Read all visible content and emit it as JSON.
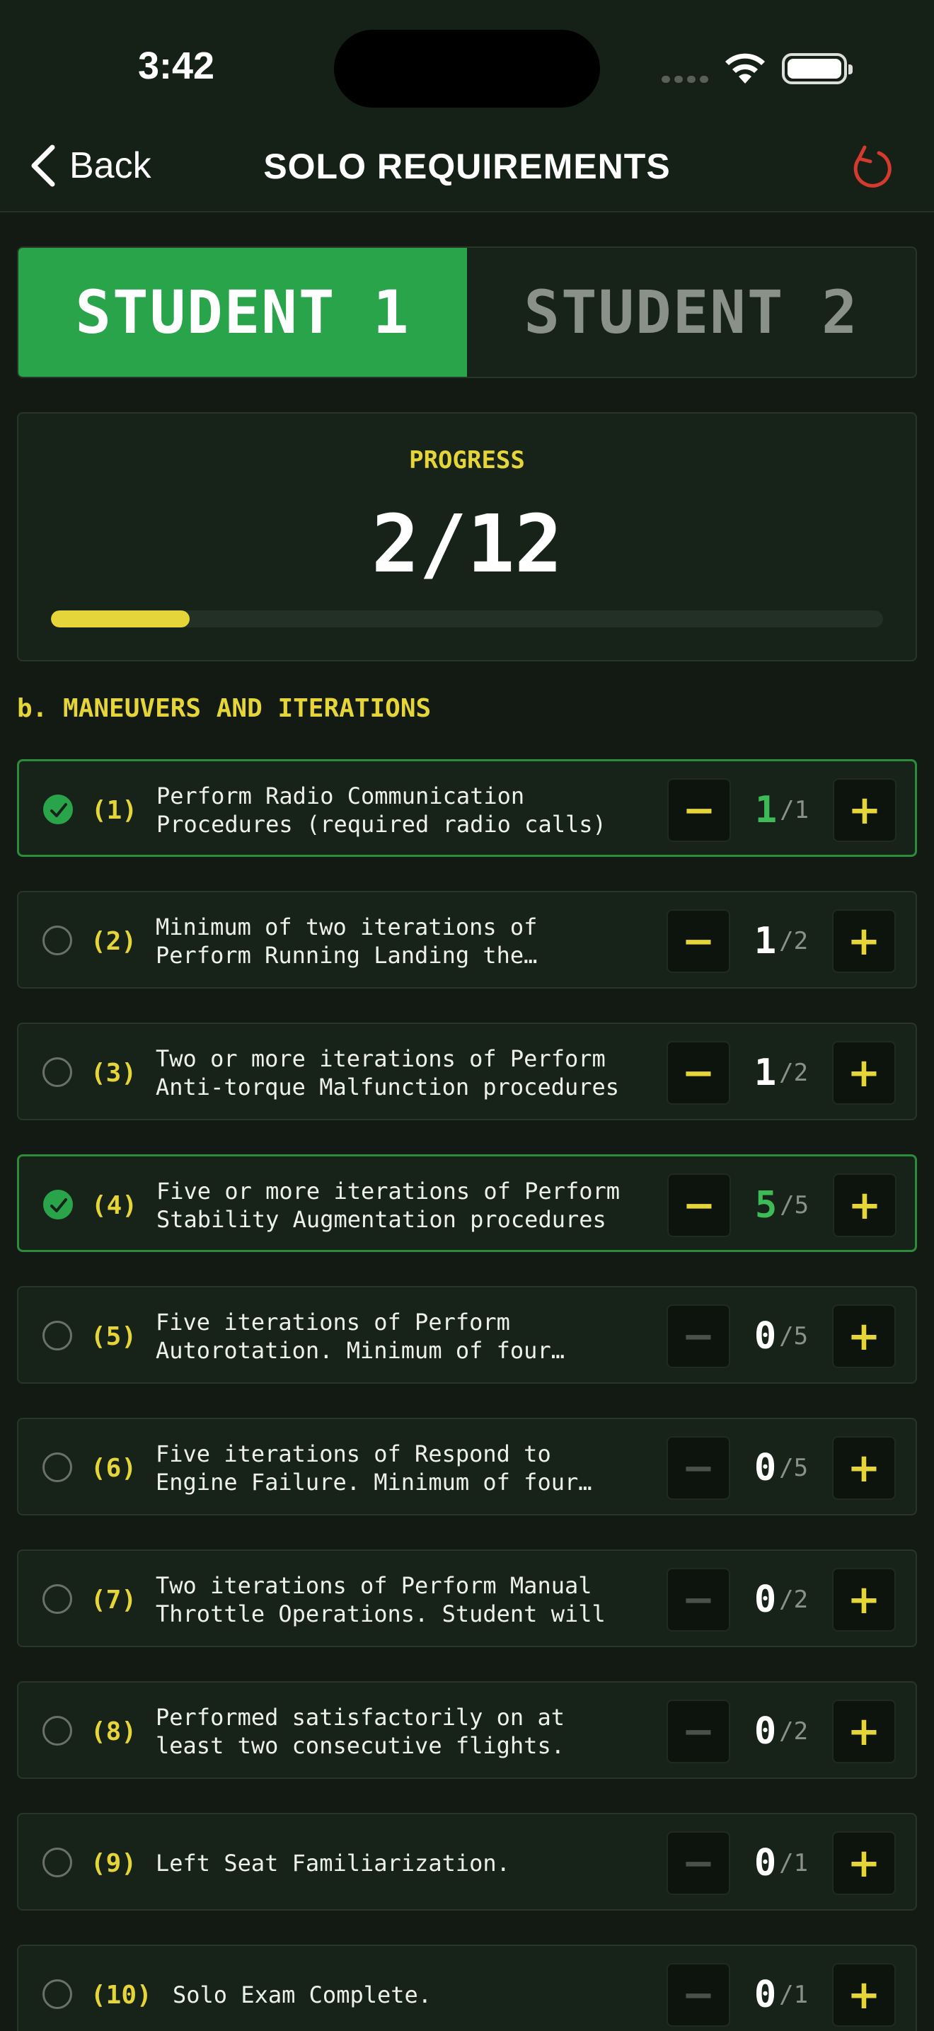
{
  "status_bar": {
    "time": "3:42"
  },
  "nav": {
    "back_label": "Back",
    "title": "SOLO REQUIREMENTS"
  },
  "tabs": [
    {
      "label": "STUDENT 1",
      "active": true
    },
    {
      "label": "STUDENT 2",
      "active": false
    }
  ],
  "progress": {
    "label": "PROGRESS",
    "value": "2/12",
    "fraction": 0.1667
  },
  "section": {
    "title": "b. MANEUVERS AND ITERATIONS"
  },
  "items": [
    {
      "num": "(1)",
      "text": "Perform Radio Communication Procedures (required radio calls)",
      "current": "1",
      "total": "/1",
      "done": true
    },
    {
      "num": "(2)",
      "text": "Minimum of two iterations of Perform Running Landing the aircraft",
      "current": "1",
      "total": "/2",
      "done": false
    },
    {
      "num": "(3)",
      "text": "Two or more iterations of Perform Anti-torque Malfunction procedures",
      "current": "1",
      "total": "/2",
      "done": false
    },
    {
      "num": "(4)",
      "text": "Five or more iterations of Perform Stability Augmentation procedures",
      "current": "5",
      "total": "/5",
      "done": true
    },
    {
      "num": "(5)",
      "text": "Five iterations of Perform Autorotation. Minimum of four iterations",
      "current": "0",
      "total": "/5",
      "done": false
    },
    {
      "num": "(6)",
      "text": "Five iterations of Respond to Engine Failure. Minimum of four iterations",
      "current": "0",
      "total": "/5",
      "done": false
    },
    {
      "num": "(7)",
      "text": "Two iterations of Perform Manual Throttle Operations. Student will",
      "current": "0",
      "total": "/2",
      "done": false
    },
    {
      "num": "(8)",
      "text": "Performed satisfactorily on at least two consecutive flights.",
      "current": "0",
      "total": "/2",
      "done": false
    },
    {
      "num": "(9)",
      "text": "Left Seat Familiarization.",
      "current": "0",
      "total": "/1",
      "done": false
    },
    {
      "num": "(10)",
      "text": "Solo Exam Complete.",
      "current": "0",
      "total": "/1",
      "done": false
    }
  ],
  "colors": {
    "accent_green": "#2aa44a",
    "accent_yellow": "#e5d538",
    "reset_red": "#d63a2f",
    "background": "#121a13"
  },
  "icons": {
    "back": "chevron-left-icon",
    "reset": "reset-arrow-icon",
    "check": "checkmark-icon",
    "minus": "minus-icon",
    "plus": "plus-icon"
  }
}
